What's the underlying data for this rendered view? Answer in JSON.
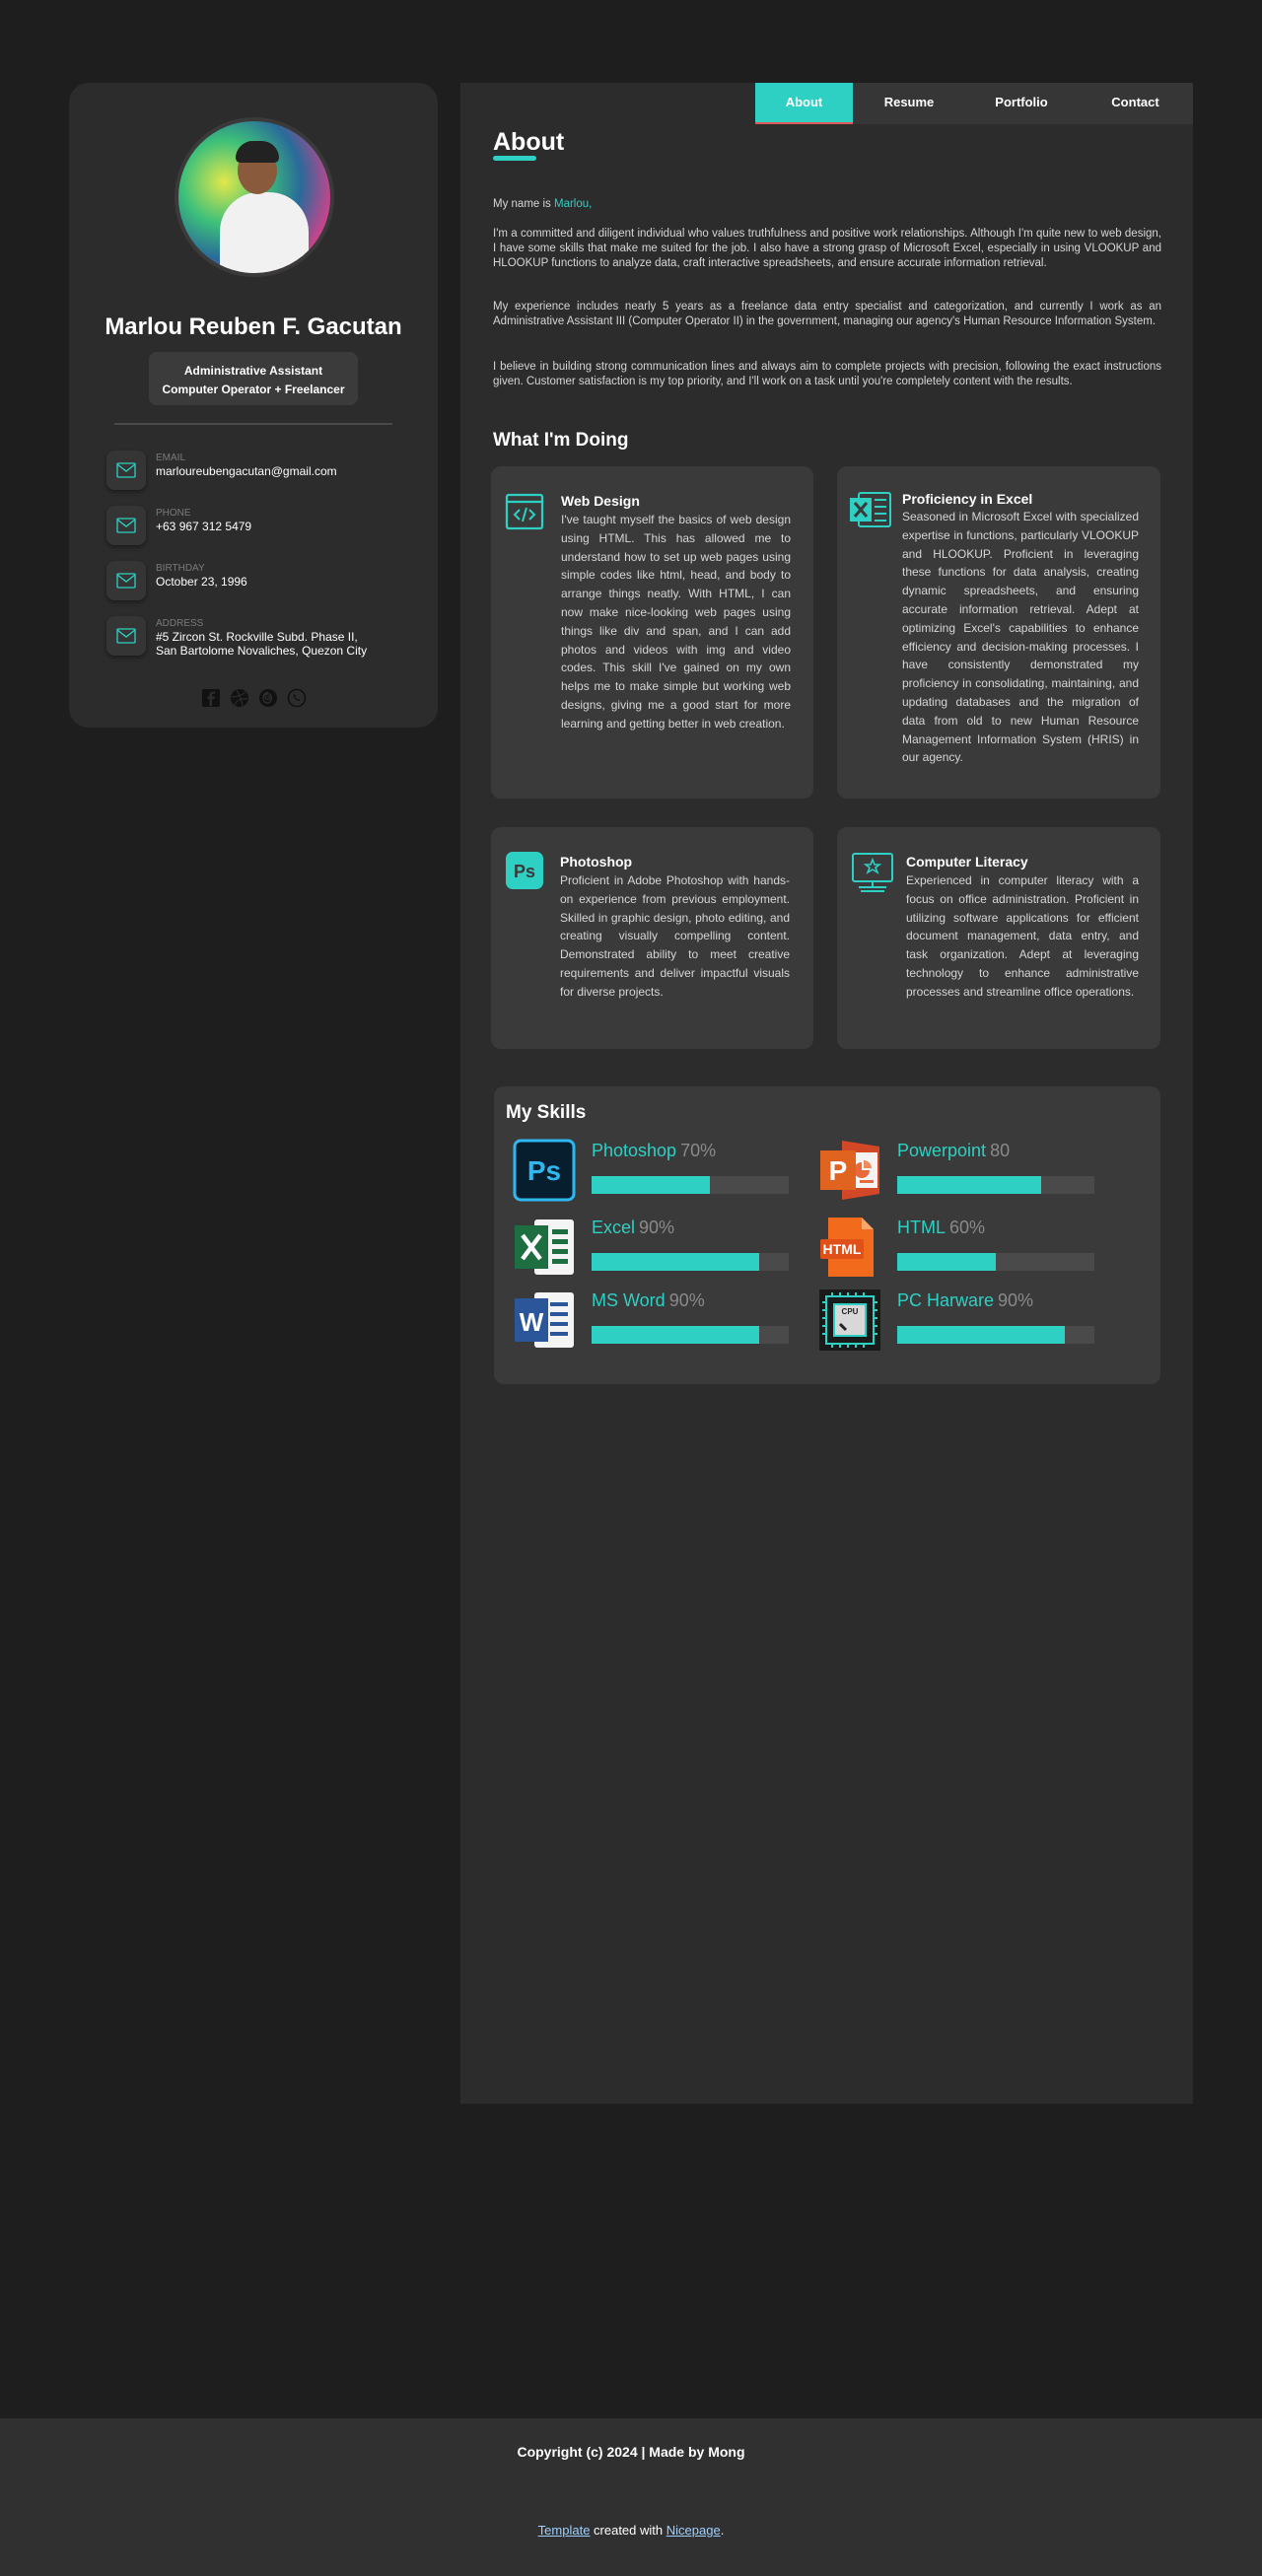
{
  "profile": {
    "name": "Marlou Reuben F. Gacutan",
    "role_line1": "Administrative Assistant",
    "role_line2": "Computer Operator + Freelancer",
    "contacts": [
      {
        "label": "EMAIL",
        "value": "marloureubengacutan@gmail.com",
        "icon": "mail-icon"
      },
      {
        "label": "PHONE",
        "value": "+63 967 312 5479",
        "icon": "mail-icon"
      },
      {
        "label": "BIRTHDAY",
        "value": "October 23, 1996",
        "icon": "mail-icon"
      },
      {
        "label": "ADDRESS",
        "value_line1": "#5 Zircon St. Rockville Subd. Phase II,",
        "value_line2": "San Bartolome Novaliches, Quezon City",
        "icon": "mail-icon"
      }
    ],
    "socials": [
      "facebook-icon",
      "dribbble-icon",
      "threads-icon",
      "viber-icon"
    ]
  },
  "nav": {
    "tabs": [
      {
        "label": "About",
        "active": true
      },
      {
        "label": "Resume",
        "active": false
      },
      {
        "label": "Portfolio",
        "active": false
      },
      {
        "label": "Contact",
        "active": false
      }
    ]
  },
  "about": {
    "title": "About",
    "intro_prefix": "My name is ",
    "intro_name": "Marlou,",
    "p1": "I'm a committed and diligent individual who values truthfulness and positive work relationships. Although I'm quite new to web design, I have some skills that make me suited for the job. I also have a strong grasp of Microsoft Excel, especially in using VLOOKUP and HLOOKUP functions to analyze data, craft interactive spreadsheets, and ensure accurate information retrieval.",
    "p2": "My experience includes nearly 5 years as a freelance data entry specialist and categorization, and currently I work as an Administrative Assistant III (Computer Operator II) in the government, managing our agency's Human Resource Information System.",
    "p3": "I believe in building strong communication lines and always aim to complete projects with precision, following the exact instructions given. Customer satisfaction is my top priority, and I'll work on a task until you're completely content with the results."
  },
  "doing": {
    "title": "What I'm Doing",
    "cards": [
      {
        "title": "Web Design",
        "icon": "code-window-icon",
        "text": "I've taught myself the basics of web design using HTML. This has allowed me to understand how to set up web pages using simple codes like html, head, and body to arrange things neatly. With HTML, I can now make nice-looking web pages using things like div and span, and I can add photos and videos with img and video codes. This skill I've gained on my own helps me to make simple but working web designs, giving me a good start for more learning and getting better in web creation."
      },
      {
        "title": "Proficiency in Excel",
        "icon": "excel-icon",
        "text": "Seasoned in Microsoft Excel with specialized expertise in functions, particularly VLOOKUP and HLOOKUP. Proficient in leveraging these functions for data analysis, creating dynamic spreadsheets, and ensuring accurate information retrieval. Adept at optimizing Excel's capabilities to enhance efficiency and decision-making processes. I have consistently demonstrated my proficiency in consolidating, maintaining, and updating databases and the migration of data from old to new Human Resource Management Information System (HRIS) in our agency."
      },
      {
        "title": "Photoshop",
        "icon": "photoshop-icon",
        "text": "Proficient in Adobe Photoshop with hands-on experience from previous employment. Skilled in graphic design, photo editing, and creating visually compelling content. Demonstrated ability to meet creative requirements and deliver impactful visuals for diverse projects."
      },
      {
        "title": "Computer Literacy",
        "icon": "monitor-star-icon",
        "text": "Experienced in computer literacy with a focus on office administration. Proficient in utilizing software applications for efficient document management, data entry, and task organization. Adept at leveraging technology to enhance administrative processes and streamline office operations."
      }
    ]
  },
  "skills": {
    "title": "My Skills",
    "items": [
      {
        "name": "Photoshop",
        "percent_label": "70%",
        "level": 0.6,
        "icon": "photoshop-icon"
      },
      {
        "name": "Powerpoint",
        "percent_label": "80",
        "level": 0.73,
        "icon": "powerpoint-icon"
      },
      {
        "name": "Excel",
        "percent_label": "90%",
        "level": 0.85,
        "icon": "excel-icon"
      },
      {
        "name": "HTML",
        "percent_label": "60%",
        "level": 0.5,
        "icon": "html-icon"
      },
      {
        "name": "MS Word",
        "percent_label": "90%",
        "level": 0.85,
        "icon": "word-icon"
      },
      {
        "name": "PC Harware",
        "percent_label": "90%",
        "level": 0.85,
        "icon": "cpu-icon"
      }
    ]
  },
  "footer": {
    "copyright": "Copyright (c) 2024 | Made by Mong",
    "credit_link1": "Template",
    "credit_mid": " created with ",
    "credit_link2": "Nicepage",
    "credit_end": "."
  },
  "colors": {
    "accent": "#2fd0c4",
    "background": "#1e1e1e",
    "panel": "#2c2c2c",
    "card": "#3a3a3a"
  }
}
